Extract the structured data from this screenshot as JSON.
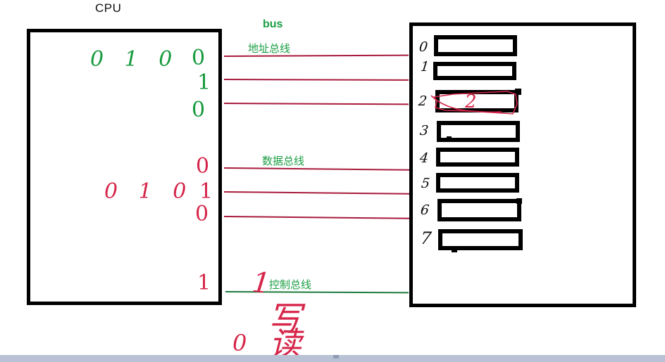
{
  "diagram": {
    "title_cpu": "CPU",
    "bus_group_label": "bus",
    "buses": [
      {
        "id": "address",
        "label": "地址总线",
        "color": "#1a9e43",
        "wire_color": "#a81b3c",
        "wire_count": 3
      },
      {
        "id": "data",
        "label": "数据总线",
        "color": "#1a9e43",
        "wire_color": "#a81b3c",
        "wire_count": 3
      },
      {
        "id": "control",
        "label": "控制总线",
        "color": "#1a9e43",
        "wire_color": "#1d7a3c",
        "wire_count": 1
      }
    ],
    "cpu": {
      "address_value_text": "0 1 0",
      "address_value_color": "#179a3e",
      "address_bits": [
        "0",
        "1",
        "0"
      ],
      "data_value_text": "0 1 0",
      "data_value_color": "#d6264a",
      "data_bits": [
        "0",
        "1",
        "0"
      ],
      "control_bit": "1"
    },
    "memory": {
      "cell_indices": [
        "0",
        "1",
        "2",
        "3",
        "4",
        "5",
        "6",
        "7"
      ],
      "selected_cell_index": "2",
      "selected_cell_annotation": "2"
    },
    "annotations": {
      "write_code": "1",
      "write_label": "写",
      "read_code": "0",
      "read_label": "读"
    }
  }
}
